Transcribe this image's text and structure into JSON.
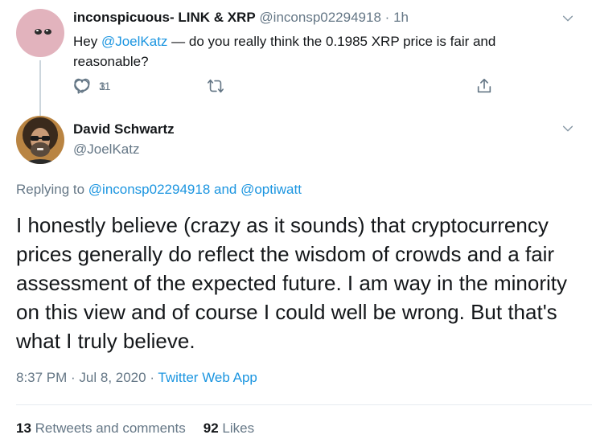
{
  "parent_tweet": {
    "display_name": "inconspicuous- LINK & XRP",
    "handle": "@inconsp02294918",
    "separator": "·",
    "time_ago": "1h",
    "text_prefix": "Hey ",
    "mention": "@JoelKatz",
    "text_suffix": " — do you really think the 0.1985 XRP price is fair and reasonable?",
    "reply_count": "3",
    "like_count": "11"
  },
  "main_tweet": {
    "display_name": "David Schwartz",
    "handle": "@JoelKatz",
    "replying_prefix": "Replying to ",
    "replying_user_1": "@inconsp02294918",
    "replying_and": " and ",
    "replying_user_2": "@optiwatt",
    "text": "I honestly believe (crazy as it sounds) that cryptocurrency prices generally do reflect the wisdom of crowds and a fair assessment of the expected future. I am way in the minority on this view and of course I could well be wrong. But that's what I truly believe.",
    "timestamp": "8:37 PM · Jul 8, 2020 · ",
    "source": "Twitter Web App",
    "retweets_count": "13",
    "retweets_label": " Retweets and comments",
    "likes_count": "92",
    "likes_label": " Likes"
  },
  "colors": {
    "link": "#1b95e0",
    "muted": "#657786",
    "text": "#14171a",
    "thread_line": "#ccd6dd"
  },
  "icons": [
    "reply-icon",
    "retweet-icon",
    "like-icon",
    "share-icon",
    "chevron-down-icon"
  ]
}
